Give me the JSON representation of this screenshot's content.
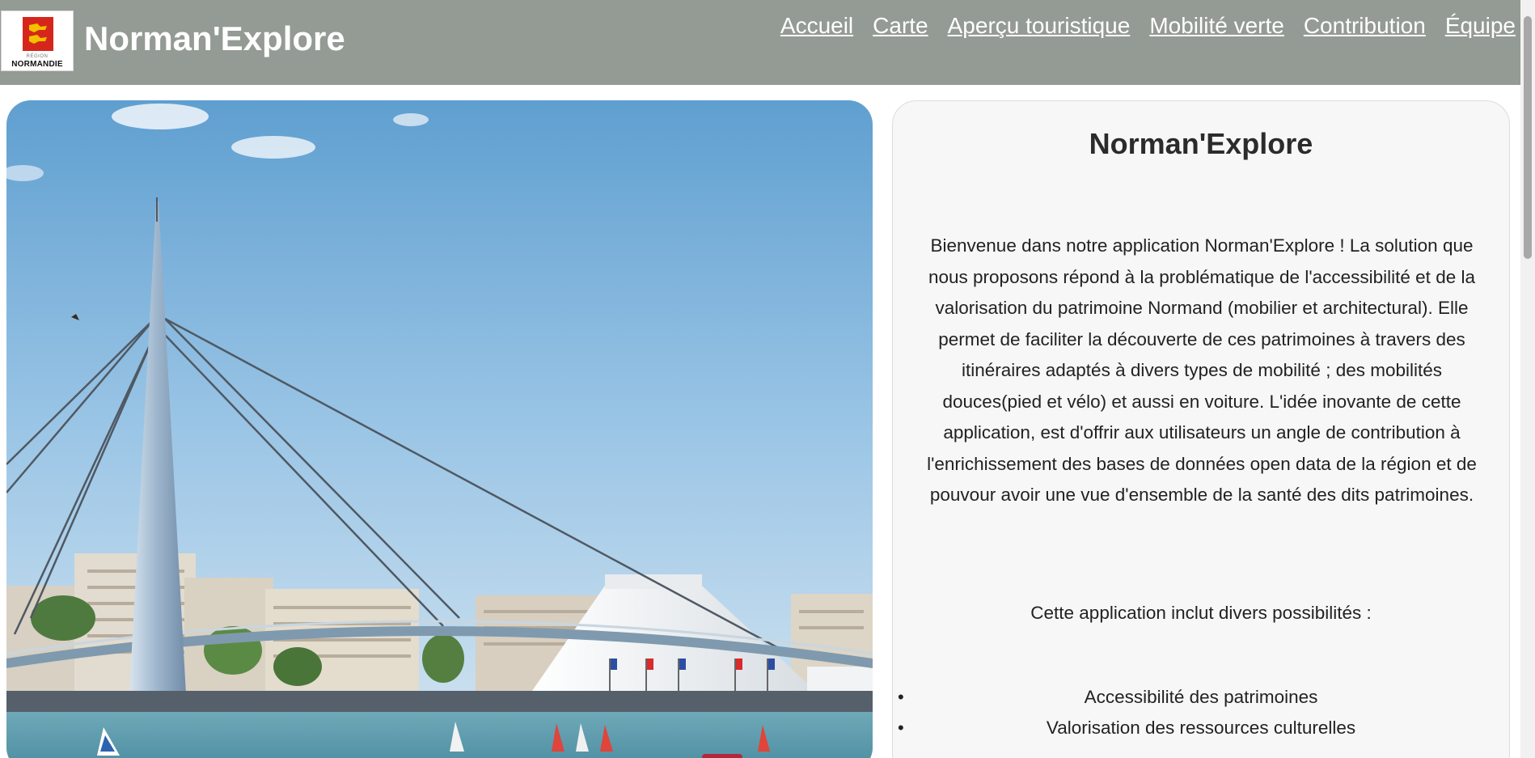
{
  "header": {
    "logo": {
      "small_text": "RÉGION",
      "name": "NORMANDIE"
    },
    "brand": "Norman'Explore",
    "nav": [
      {
        "label": "Accueil"
      },
      {
        "label": "Carte"
      },
      {
        "label": "Aperçu touristique"
      },
      {
        "label": "Mobilité verte"
      },
      {
        "label": "Contribution"
      },
      {
        "label": "Équipe"
      }
    ]
  },
  "hero": {
    "icon": "harbour-bridge-photo"
  },
  "panel": {
    "title": "Norman'Explore",
    "intro": "Bienvenue dans notre application Norman'Explore ! La solution que nous proposons répond à la problématique de l'accessibilité et de la valorisation du patrimoine Normand (mobilier et architectural). Elle permet de faciliter la découverte de ces patrimoines à travers des itinéraires adaptés à divers types de mobilité ; des mobilités douces(pied et vélo) et aussi en voiture. L'idée inovante de cette application, est d'offrir aux utilisateurs un angle de contribution à l'enrichissement des bases de données open data de la région et de pouvour avoir une vue d'ensemble de la santé des dits patrimoines.",
    "subtitle": "Cette application inclut divers possibilités :",
    "features": [
      "Accessibilité des patrimoines",
      "Valorisation des ressources culturelles"
    ]
  },
  "colors": {
    "header_bg": "#949a94",
    "panel_bg": "#f7f7f7",
    "logo_red": "#d6261c",
    "logo_gold": "#f2c200"
  }
}
